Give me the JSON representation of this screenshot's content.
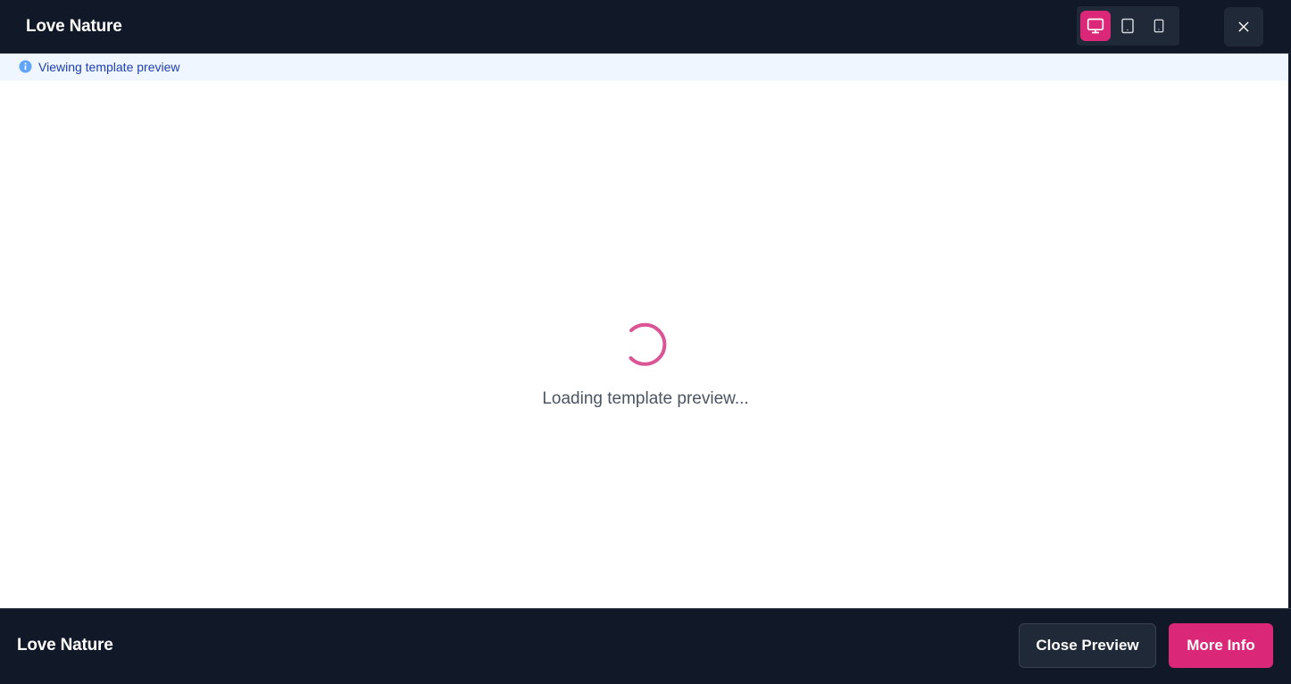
{
  "header": {
    "title": "Love Nature",
    "device_modes": [
      {
        "name": "desktop",
        "icon": "monitor-icon",
        "active": true
      },
      {
        "name": "tablet",
        "icon": "tablet-icon",
        "active": false
      },
      {
        "name": "mobile",
        "icon": "smartphone-icon",
        "active": false
      }
    ],
    "close_icon": "close-icon"
  },
  "info_bar": {
    "icon": "info-icon",
    "text": "Viewing template preview"
  },
  "main": {
    "spinner_icon": "spinner-icon",
    "loading_text": "Loading template preview..."
  },
  "footer": {
    "title": "Love Nature",
    "close_preview_label": "Close Preview",
    "more_info_label": "More Info"
  },
  "colors": {
    "dark_bg": "#111827",
    "accent": "#db2777",
    "info_bg": "#eff6ff",
    "info_text": "#1e40af"
  }
}
